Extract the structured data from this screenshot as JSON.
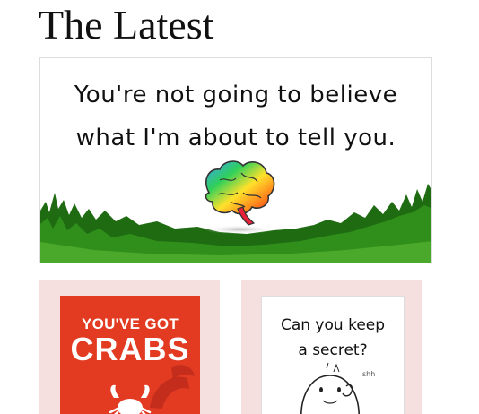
{
  "section": {
    "title": "The Latest"
  },
  "hero": {
    "line1": "You're not going to believe",
    "line2": "what I'm about to tell you.",
    "icon": "rainbow-brain-icon"
  },
  "cards": [
    {
      "top_text": "YOU'VE GOT",
      "big_text": "CRABS",
      "icon": "crab-icon",
      "background": "#e23b22"
    },
    {
      "line1": "Can you keep",
      "line2": "a secret?",
      "whisper": "shh",
      "icon": "blob-character-icon"
    }
  ],
  "colors": {
    "card_background": "#f6dfdf",
    "grass": "#1f6b12"
  }
}
